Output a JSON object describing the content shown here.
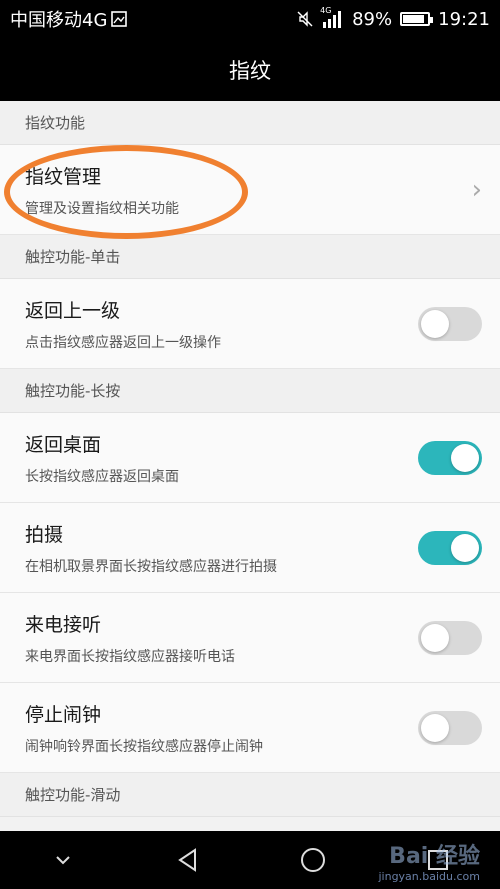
{
  "status_bar": {
    "carrier": "中国移动4G",
    "net": "4G",
    "battery": "89%",
    "battery_level": 0.89,
    "time": "19:21"
  },
  "title": "指纹",
  "sections": [
    {
      "header": "指纹功能",
      "rows": [
        {
          "title": "指纹管理",
          "subtitle": "管理及设置指纹相关功能",
          "control": "chevron"
        }
      ]
    },
    {
      "header": "触控功能-单击",
      "rows": [
        {
          "title": "返回上一级",
          "subtitle": "点击指纹感应器返回上一级操作",
          "control": "toggle",
          "on": false
        }
      ]
    },
    {
      "header": "触控功能-长按",
      "rows": [
        {
          "title": "返回桌面",
          "subtitle": "长按指纹感应器返回桌面",
          "control": "toggle",
          "on": true
        },
        {
          "title": "拍摄",
          "subtitle": "在相机取景界面长按指纹感应器进行拍摄",
          "control": "toggle",
          "on": true
        },
        {
          "title": "来电接听",
          "subtitle": "来电界面长按指纹感应器接听电话",
          "control": "toggle",
          "on": false
        },
        {
          "title": "停止闹钟",
          "subtitle": "闹钟响铃界面长按指纹感应器停止闹钟",
          "control": "toggle",
          "on": false
        }
      ]
    },
    {
      "header": "触控功能-滑动",
      "rows": []
    }
  ],
  "colors": {
    "toggle_on": "#2cb6bb",
    "toggle_off": "#d9d9d9",
    "highlight": "#f08030"
  },
  "nav_icons": [
    "chevron-down-icon",
    "back-triangle-icon",
    "home-circle-icon",
    "recents-square-icon"
  ],
  "watermark": {
    "main": "Bai 经验",
    "sub": "jingyan.baidu.com"
  }
}
